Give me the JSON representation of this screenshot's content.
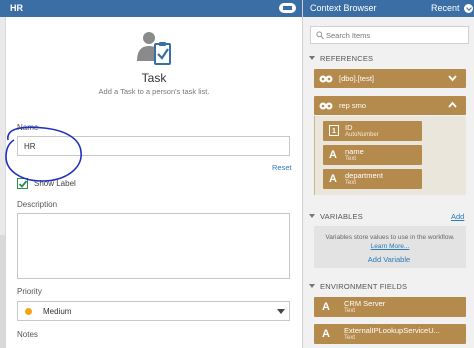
{
  "task_panel": {
    "header_title": "HR",
    "task_title": "Task",
    "task_subtitle": "Add a Task to a person's task list.",
    "name_label": "Name",
    "name_value": "HR",
    "reset_label": "Reset",
    "show_label_text": "Show Label",
    "show_label_checked": true,
    "description_label": "Description",
    "priority_label": "Priority",
    "priority_value": "Medium",
    "priority_color": "#f2a516",
    "notes_label": "Notes"
  },
  "context_browser": {
    "title": "Context Browser",
    "recent_label": "Recent",
    "search_placeholder": "Search Items",
    "references_heading": "REFERENCES",
    "references": [
      {
        "label": "[dbo].[test]",
        "expanded": false
      },
      {
        "label": "rep smo",
        "expanded": true
      }
    ],
    "fields": [
      {
        "name": "ID",
        "type": "AutoNumber"
      },
      {
        "name": "name",
        "type": "Text"
      },
      {
        "name": "department",
        "type": "Text"
      }
    ],
    "variables_heading": "VARIABLES",
    "variables_add": "Add",
    "variables_info": "Variables store values to use in the workflow.",
    "variables_learn_more": "Learn More...",
    "add_variable_label": "Add Variable",
    "environment_heading": "ENVIRONMENT FIELDS",
    "environment_fields": [
      {
        "name": "CRM Server",
        "type": "Text"
      },
      {
        "name": "ExternalIPLookupServiceU...",
        "type": "Text"
      }
    ]
  },
  "colors": {
    "header_blue": "#3a6ea5",
    "reference_tan": "#b58a4d",
    "link_blue": "#2a7ab8",
    "annotation_circle": "#1f2fbf"
  }
}
